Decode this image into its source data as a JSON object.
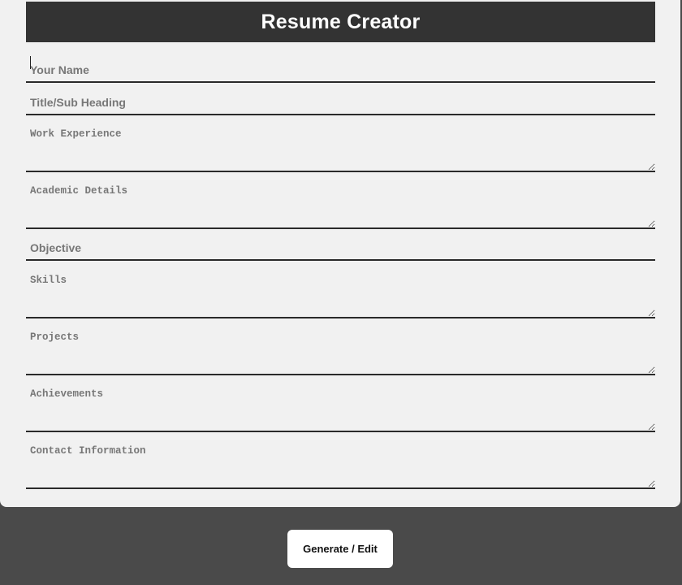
{
  "header": {
    "title": "Resume Creator"
  },
  "form": {
    "name_placeholder": "Your Name",
    "title_placeholder": "Title/Sub Heading",
    "work_placeholder": "Work Experience",
    "academic_placeholder": "Academic Details",
    "objective_placeholder": "Objective",
    "skills_placeholder": "Skills",
    "projects_placeholder": "Projects",
    "achievements_placeholder": "Achievements",
    "contact_placeholder": "Contact Information"
  },
  "actions": {
    "generate_label": "Generate / Edit"
  },
  "colors": {
    "page_background": "#4a4a4a",
    "card_background": "#f1f1f1",
    "header_background": "#333333",
    "button_background": "#ffffff"
  }
}
